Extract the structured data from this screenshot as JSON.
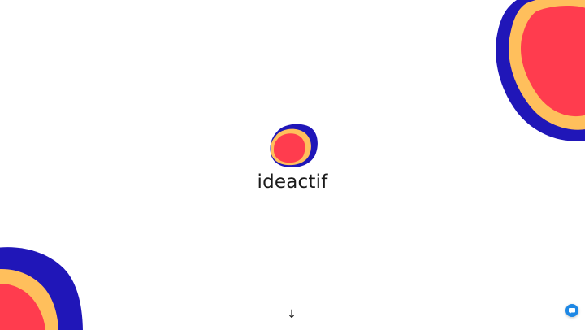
{
  "brand": {
    "name": "ideactif",
    "logo_icon": "ideactif-logo-icon",
    "colors": {
      "outer": "#2016b8",
      "middle": "#ffbf5c",
      "inner": "#ff3c4e"
    }
  },
  "scroll_hint": {
    "glyph": "↓",
    "icon": "arrow-down-icon"
  },
  "chat_widget": {
    "icon": "chat-bubble-icon",
    "color": "#1e88e5"
  }
}
